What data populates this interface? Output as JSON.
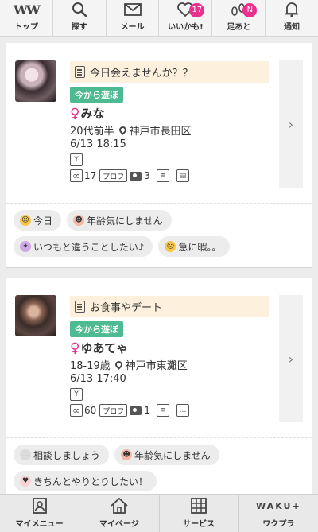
{
  "topnav": {
    "items": [
      {
        "label": "トップ",
        "icon": "ww-logo-icon",
        "logo_text": "WW"
      },
      {
        "label": "探す",
        "icon": "search-icon"
      },
      {
        "label": "メール",
        "icon": "mail-icon"
      },
      {
        "label": "いいかも!",
        "icon": "heart-icon",
        "badge": "17"
      },
      {
        "label": "足あと",
        "icon": "footprint-icon",
        "badge": "N"
      },
      {
        "label": "通知",
        "icon": "bell-icon"
      }
    ]
  },
  "cards": [
    {
      "message": "今日会えませんか？？",
      "tag": "今から遊ぼ",
      "name": "みな",
      "age": "20代前半",
      "location": "神戸市長田区",
      "datetime": "6/13 18:15",
      "views": "17",
      "profile_label": "プロフ",
      "photos": "3",
      "chips": [
        [
          "今日",
          "年齢気にしません"
        ],
        [
          "いつもと違うことしたい♪",
          "急に暇。。"
        ]
      ]
    },
    {
      "message": "お食事やデート",
      "tag": "今から遊ぼ",
      "name": "ゆあてゃ",
      "age": "18-19歳",
      "location": "神戸市東灘区",
      "datetime": "6/13 17:40",
      "views": "60",
      "profile_label": "プロフ",
      "photos": "1",
      "chips": [
        [
          "相談しましょう",
          "年齢気にしません"
        ],
        [
          "きちんとやりとりしたい！"
        ]
      ]
    }
  ],
  "bottomnav": {
    "items": [
      {
        "label": "マイメニュー",
        "icon": "profile-icon"
      },
      {
        "label": "マイページ",
        "icon": "home-icon"
      },
      {
        "label": "サービス",
        "icon": "grid-icon"
      },
      {
        "label": "ワクプラ",
        "icon": "waku-plus-icon",
        "logo_text": "WAKU+"
      }
    ]
  },
  "colors": {
    "accent_pink": "#e8308e",
    "tag_green": "#4dba91",
    "message_bg": "#fdf0dc"
  }
}
